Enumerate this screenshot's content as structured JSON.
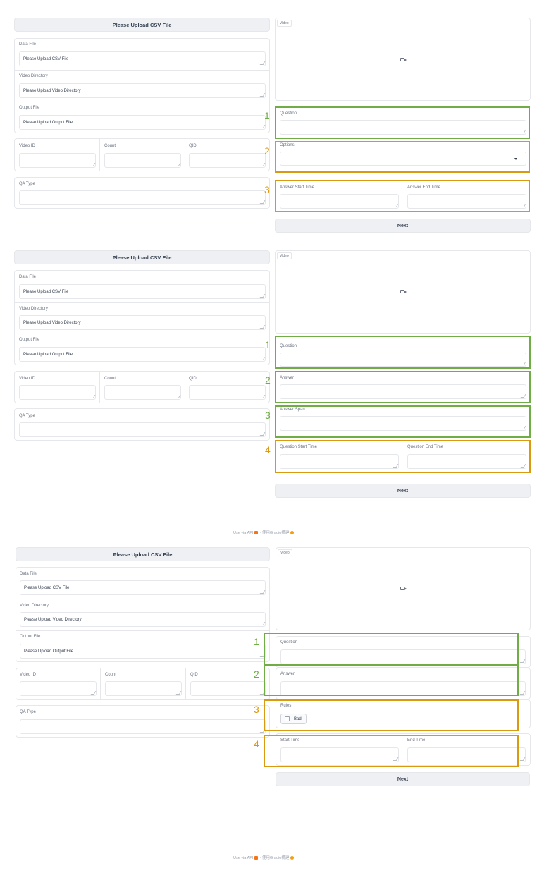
{
  "panels": [
    {
      "upload_button": "Please Upload CSV File",
      "data_file_label": "Data File",
      "data_file_value": "Please Upload CSV File",
      "video_dir_label": "Video Directory",
      "video_dir_value": "Please Upload Video Directory",
      "output_file_label": "Output File",
      "output_file_value": "Please Upload Output File",
      "video_id_label": "Video ID",
      "count_label": "Count",
      "qid_label": "QID",
      "qa_type_label": "QA Type",
      "video_tag": "Video",
      "next": "Next",
      "right_fields": {
        "question": "Question",
        "options": "Options",
        "answer_start": "Answer Start Time",
        "answer_end": "Answer End Time"
      },
      "markers": [
        "1",
        "2",
        "3"
      ]
    },
    {
      "upload_button": "Please Upload CSV File",
      "data_file_label": "Data File",
      "data_file_value": "Please Upload CSV File",
      "video_dir_label": "Video Directory",
      "video_dir_value": "Please Upload Video Directory",
      "output_file_label": "Output File",
      "output_file_value": "Please Upload Output File",
      "video_id_label": "Video ID",
      "count_label": "Count",
      "qid_label": "QID",
      "qa_type_label": "QA Type",
      "video_tag": "Video",
      "next": "Next",
      "right_fields": {
        "question": "Question",
        "answer": "Answer",
        "answer_span": "Answer Span",
        "question_start": "Question Start Time",
        "question_end": "Question End Time"
      },
      "markers": [
        "1",
        "2",
        "3",
        "4"
      ]
    },
    {
      "upload_button": "Please Upload CSV File",
      "data_file_label": "Data File",
      "data_file_value": "Please Upload CSV File",
      "video_dir_label": "Video Directory",
      "video_dir_value": "Please Upload Video Directory",
      "output_file_label": "Output File",
      "output_file_value": "Please Upload Output File",
      "video_id_label": "Video ID",
      "count_label": "Count",
      "qid_label": "QID",
      "qa_type_label": "QA Type",
      "video_tag": "Video",
      "next": "Next",
      "right_fields": {
        "question": "Question",
        "answer": "Answer",
        "rules": "Rules",
        "bad": "Bad",
        "start_time": "Start Time",
        "end_time": "End Time"
      },
      "markers": [
        "1",
        "2",
        "3",
        "4"
      ]
    }
  ],
  "footer": {
    "api": "Use via API",
    "sep": "·",
    "built": "使用Gradio構建"
  },
  "colors": {
    "green": "#70ad47",
    "orange": "#d99a12"
  }
}
